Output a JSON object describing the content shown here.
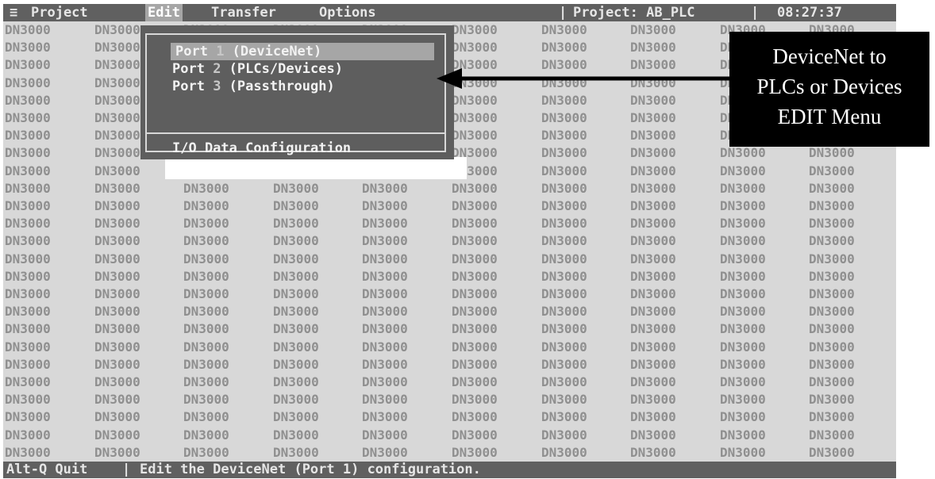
{
  "menubar": {
    "system_glyph": "≡",
    "items": [
      "Project",
      "Edit",
      "Transfer",
      "Options"
    ],
    "project_label": "Project: AB_PLC",
    "clock": "08:27:37"
  },
  "wallpaper_text": "DN3000",
  "edit_menu": {
    "items": [
      {
        "prefix": "Port ",
        "num": "1",
        "suffix": " (DeviceNet)"
      },
      {
        "prefix": "Port ",
        "num": "2",
        "suffix": " (PLCs/Devices)"
      },
      {
        "prefix": "Port ",
        "num": "3",
        "suffix": " (Passthrough)"
      }
    ],
    "io_item": "I/O Data Configuration",
    "selected_index": 0
  },
  "statusbar": {
    "quit": "Alt-Q Quit",
    "message": "Edit the DeviceNet (Port 1) configuration."
  },
  "callout": {
    "line1": "DeviceNet to",
    "line2": "PLCs or Devices",
    "line3": "EDIT Menu"
  },
  "colors": {
    "bar": "#606060",
    "background": "#d8d8d8",
    "menu": "#5e5e5e",
    "selection": "#a6a6a6",
    "callout": "#000000"
  }
}
